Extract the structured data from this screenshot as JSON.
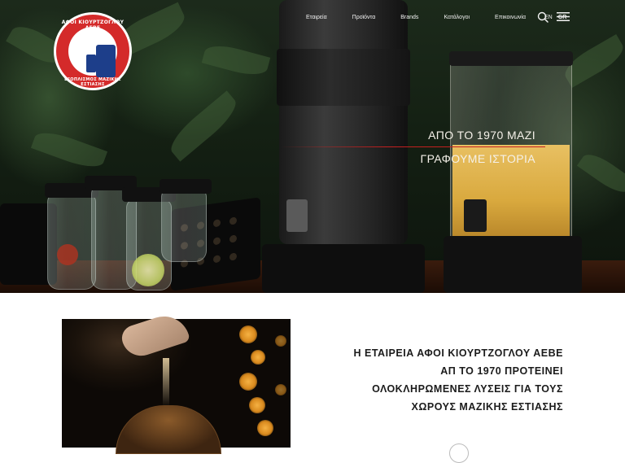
{
  "brand": {
    "logo_top_text": "ΑΦΟΙ ΚΙΟΥΡΤΖΟΓΛΟΥ ΑΕΒΕ",
    "logo_bottom_text": "ΕΞΟΠΛΙΣΜΟΣ ΜΑΖΙΚΗΣ ΕΣΤΙΑΣΗΣ"
  },
  "nav": {
    "items": [
      "Εταιρεία",
      "Προϊόντα",
      "Brands",
      "Κατάλογοι",
      "Επικοινωνία"
    ],
    "languages": [
      "EN",
      "GR"
    ],
    "active_language": "GR"
  },
  "hero": {
    "headline_line1": "ΑΠΟ ΤΟ 1970 ΜΑΖΙ",
    "headline_line2": "ΓΡΑΦΟΥΜΕ ΙΣΤΟΡΙΑ"
  },
  "intro": {
    "lines": [
      "Η ΕΤΑΙΡΕΙΑ ΑΦΟΙ ΚΙΟΥΡΤΖΟΓΛΟΥ ΑΕΒΕ",
      "ΑΠ ΤΟ 1970 ΠΡΟΤΕΙΝΕΙ",
      "ΟΛΟΚΛΗΡΩΜΕΝΕΣ ΛΥΣΕΙΣ ΓΙΑ ΤΟΥΣ",
      "ΧΩΡΟΥΣ ΜΑΖΙΚΗΣ ΕΣΤΙΑΣΗΣ"
    ]
  },
  "icons": {
    "search": "search-icon",
    "menu": "hamburger-menu-icon"
  },
  "colors": {
    "accent_red": "#c42020",
    "logo_red": "#d42a2a",
    "logo_blue": "#1d3e8a",
    "hero_text": "#f5f1e9",
    "body_text": "#1b1b1b"
  }
}
